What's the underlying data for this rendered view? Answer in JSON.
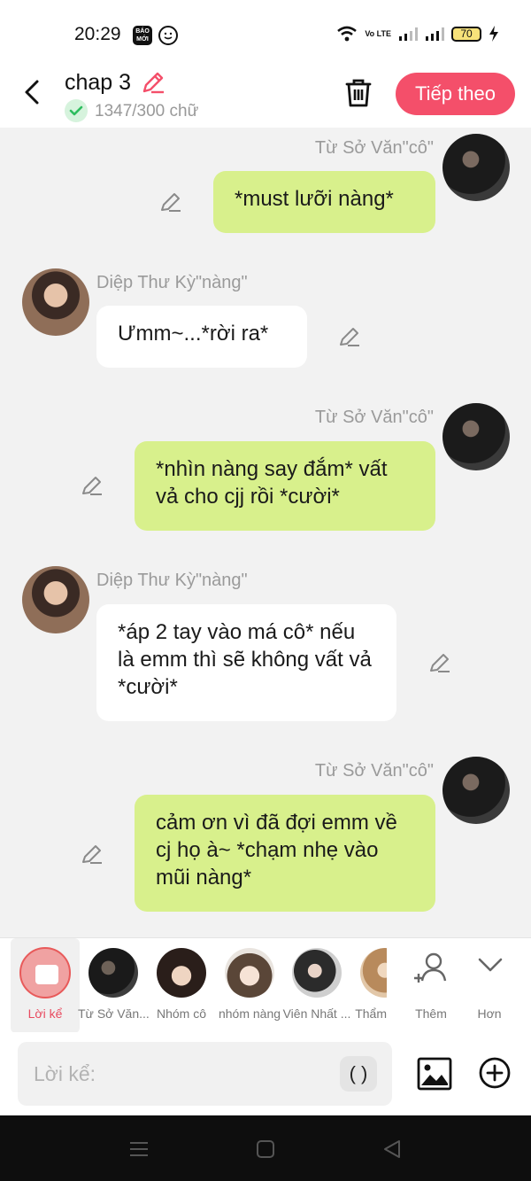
{
  "status_bar": {
    "time": "20:29",
    "baomoi": "BÁO MỚI",
    "volte": "Vo LTE",
    "battery": "70"
  },
  "header": {
    "title": "chap 3",
    "word_count": "1347/300 chữ",
    "next_label": "Tiếp theo",
    "accent_color": "#f44f6a"
  },
  "messages": [
    {
      "sender": "Từ Sở Văn\"cô\"",
      "text": "*must lưỡi nàng*",
      "side": "right"
    },
    {
      "sender": "Diệp Thư Kỳ\"nàng\"",
      "text": "Ưmm~...*rời ra*",
      "side": "left"
    },
    {
      "sender": "Từ Sở Văn\"cô\"",
      "text": "*nhìn nàng say đắm* vất vả cho cjj rồi *cười*",
      "side": "right"
    },
    {
      "sender": "Diệp Thư Kỳ\"nàng\"",
      "text": "*áp 2 tay vào má cô* nếu là emm thì sẽ không vất vả *cười*",
      "side": "left"
    },
    {
      "sender": "Từ Sở Văn\"cô\"",
      "text": "cảm ơn vì đã đợi emm về cj họ à~ *chạm nhẹ vào mũi nàng*",
      "side": "right"
    }
  ],
  "characters": [
    {
      "label": "Lời kể"
    },
    {
      "label": "Từ Sở Văn..."
    },
    {
      "label": "Nhóm cô"
    },
    {
      "label": "nhóm nàng"
    },
    {
      "label": "Viên Nhất ..."
    },
    {
      "label": "Thẩm"
    }
  ],
  "more_label": "Thêm",
  "less_label": "Hơn",
  "input": {
    "placeholder": "Lời kể:",
    "paren_label": "( )"
  },
  "colors": {
    "right_bubble": "#d8f08c",
    "left_bubble": "#ffffff"
  }
}
